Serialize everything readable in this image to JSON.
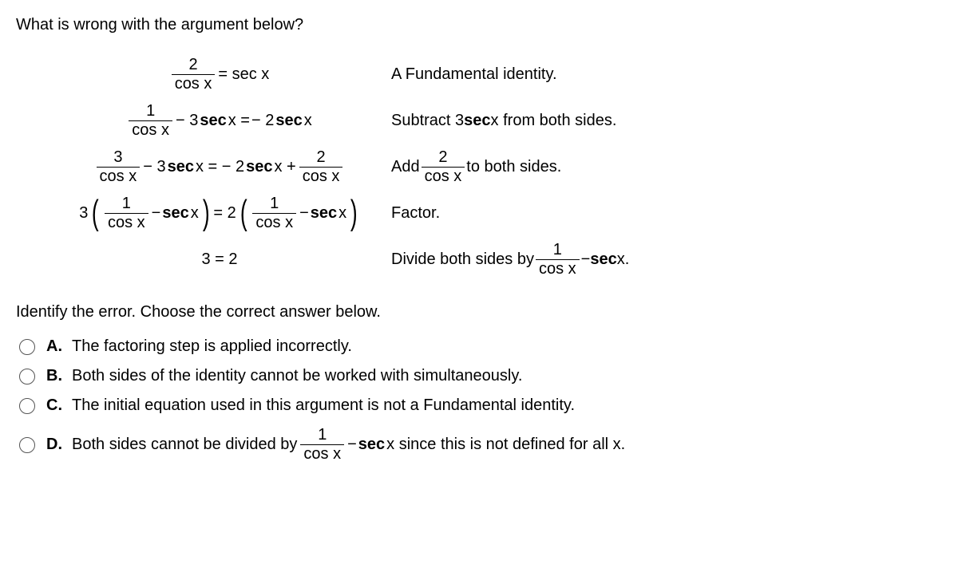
{
  "question": "What is wrong with the argument below?",
  "steps": {
    "s1": {
      "lhs_num": "2",
      "lhs_den": "cos x",
      "eq": " = sec x",
      "reason": "A Fundamental identity."
    },
    "s2": {
      "a_num": "1",
      "a_den": "cos x",
      "mid": " − 3 ",
      "secx": "sec",
      "x": " x = ",
      "rhs": "− 2 ",
      "secx2": "sec",
      "x2": " x",
      "reason_pre": "Subtract 3 ",
      "reason_bold": "sec",
      "reason_post": " x from both sides."
    },
    "s3": {
      "a_num": "3",
      "a_den": "cos x",
      "mid": " − 3 ",
      "secx": "sec",
      "x": " x = − 2 ",
      "secx2": "sec",
      "x2": " x + ",
      "b_num": "2",
      "b_den": "cos x",
      "reason_pre": "Add ",
      "reason_frac_num": "2",
      "reason_frac_den": "cos x",
      "reason_post": " to both sides."
    },
    "s4": {
      "lead": "3",
      "a_num": "1",
      "a_den": "cos x",
      "mid1": " − ",
      "secx": "sec",
      "x": " x",
      "eq": " = 2",
      "b_num": "1",
      "b_den": "cos x",
      "mid2": " − ",
      "secx2": "sec",
      "x2": " x",
      "reason": "Factor."
    },
    "s5": {
      "eq": "3 = 2",
      "reason_pre": "Divide both sides by ",
      "reason_frac_num": "1",
      "reason_frac_den": "cos x",
      "reason_mid": " − ",
      "reason_bold": "sec",
      "reason_post": " x."
    }
  },
  "identify": "Identify the error. Choose the correct answer below.",
  "options": {
    "A": {
      "letter": "A.",
      "text": "The factoring step is applied incorrectly."
    },
    "B": {
      "letter": "B.",
      "text": "Both sides of the identity cannot be worked with simultaneously."
    },
    "C": {
      "letter": "C.",
      "text": "The initial equation used in this argument is not a Fundamental identity."
    },
    "D": {
      "letter": "D.",
      "pre": "Both sides cannot be divided by ",
      "frac_num": "1",
      "frac_den": "cos x",
      "mid": " − ",
      "bold": "sec",
      "post": " x since this is not defined for all x."
    }
  }
}
